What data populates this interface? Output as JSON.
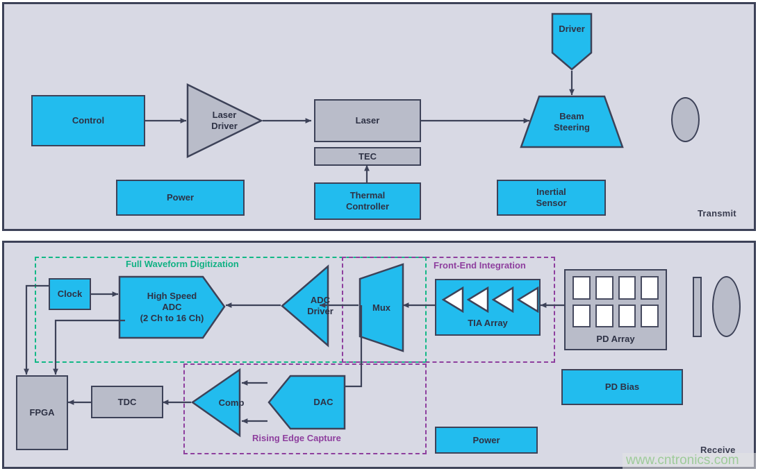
{
  "theme": {
    "panel_bg": "#d8d9e4",
    "stroke": "#3d4258",
    "cyan": "#22bcee",
    "gray": "#b9bcc9",
    "green": "#10b183",
    "purple": "#8e3f9e",
    "text": "#2e3245",
    "watermark_color": "#9ecb9a"
  },
  "transmit": {
    "panel_label": "Transmit",
    "blocks": {
      "control": "Control",
      "laser_driver": "Laser\nDriver",
      "laser_driver_line1": "Laser",
      "laser_driver_line2": "Driver",
      "laser": "Laser",
      "tec": "TEC",
      "thermal_controller_line1": "Thermal",
      "thermal_controller_line2": "Controller",
      "power": "Power",
      "driver": "Driver",
      "beam_steering_line1": "Beam",
      "beam_steering_line2": "Steering",
      "inertial_sensor_line1": "Inertial",
      "inertial_sensor_line2": "Sensor",
      "lens": "tx-lens"
    }
  },
  "receive": {
    "panel_label": "Receive",
    "blocks": {
      "clock": "Clock",
      "adc_line1": "High Speed",
      "adc_line2": "ADC",
      "adc_line3": "(2 Ch to 16 Ch)",
      "adc_driver_line1": "ADC",
      "adc_driver_line2": "Driver",
      "mux": "Mux",
      "tia_array": "TIA Array",
      "pd_array": "PD Array",
      "pd_bias": "PD Bias",
      "power": "Power",
      "fpga": "FPGA",
      "tdc": "TDC",
      "comp": "Comp",
      "dac": "DAC",
      "filter": "rx-filter",
      "lens": "rx-lens"
    },
    "regions": [
      {
        "id": "full-waveform-digitization",
        "label": "Full Waveform Digitization",
        "color": "green"
      },
      {
        "id": "front-end-integration",
        "label": "Front-End Integration",
        "color": "purple"
      },
      {
        "id": "rising-edge-capture",
        "label": "Rising Edge Capture",
        "color": "purple"
      }
    ],
    "tia_amplifier_count": 4,
    "pd_array_rows": 2,
    "pd_array_cols": 4
  },
  "watermark": {
    "text": "www.cntronics.com"
  }
}
